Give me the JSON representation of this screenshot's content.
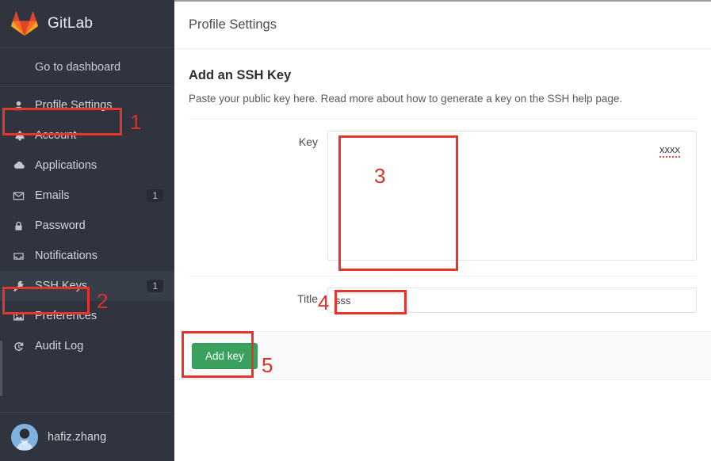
{
  "app": {
    "brand_name": "GitLab",
    "logo_icon": "gitlab-tanuki-icon"
  },
  "sidebar": {
    "dashboard_link": "Go to dashboard",
    "items": [
      {
        "label": "Profile Settings",
        "icon": "user-icon",
        "badge": "",
        "active": false
      },
      {
        "label": "Account",
        "icon": "gear-icon",
        "badge": "",
        "active": false
      },
      {
        "label": "Applications",
        "icon": "cloud-icon",
        "badge": "",
        "active": false
      },
      {
        "label": "Emails",
        "icon": "envelope-icon",
        "badge": "1",
        "active": false
      },
      {
        "label": "Password",
        "icon": "lock-icon",
        "badge": "",
        "active": false
      },
      {
        "label": "Notifications",
        "icon": "inbox-icon",
        "badge": "",
        "active": false
      },
      {
        "label": "SSH Keys",
        "icon": "key-icon",
        "badge": "1",
        "active": true
      },
      {
        "label": "Preferences",
        "icon": "image-icon",
        "badge": "",
        "active": false
      },
      {
        "label": "Audit Log",
        "icon": "history-clock-icon",
        "badge": "",
        "active": false
      }
    ],
    "user": {
      "name": "hafiz.zhang",
      "avatar_icon": "user-avatar"
    }
  },
  "header": {
    "title": "Profile Settings"
  },
  "main": {
    "section_title": "Add an SSH Key",
    "description_before": "Paste your public key here. Read more about how to generate a key on the ",
    "description_link": "SSH help page",
    "description_after": ".",
    "fields": {
      "key": {
        "label": "Key",
        "value": "xxxx",
        "placeholder": ""
      },
      "title": {
        "label": "Title",
        "value": "sss",
        "placeholder": ""
      }
    },
    "submit_label": "Add key"
  },
  "annotations": {
    "color": "#e8352b",
    "markers": [
      {
        "number": "1",
        "target": "sidebar-item-profile-settings"
      },
      {
        "number": "2",
        "target": "sidebar-item-ssh-keys"
      },
      {
        "number": "3",
        "target": "key-textarea"
      },
      {
        "number": "4",
        "target": "title-input"
      },
      {
        "number": "5",
        "target": "add-key-button"
      }
    ]
  }
}
